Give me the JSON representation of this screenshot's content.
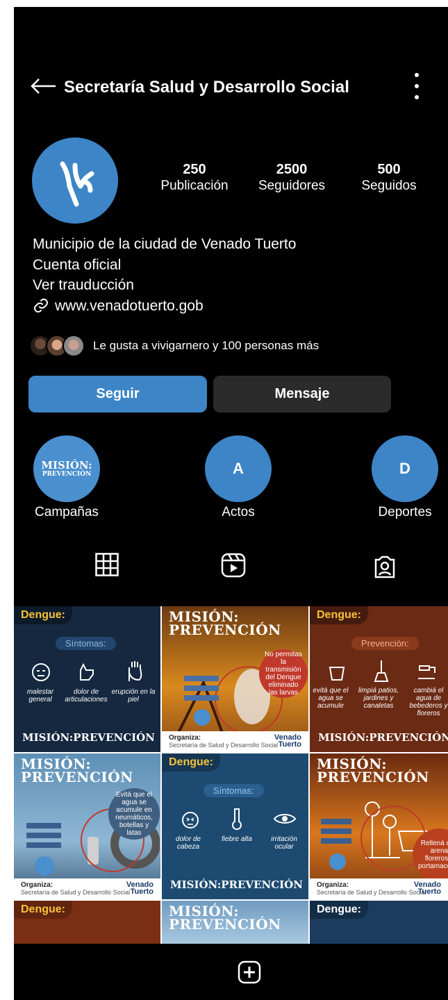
{
  "header": {
    "title": "Secretaría Salud y Desarrollo Social",
    "back_icon": "arrow-left-icon",
    "more_icon": "more-vertical-icon"
  },
  "profile": {
    "avatar_icon": "venado-tuerto-logo",
    "stats": [
      {
        "value": "250",
        "label": "Publicación"
      },
      {
        "value": "2500",
        "label": "Seguidores"
      },
      {
        "value": "500",
        "label": "Seguidos"
      }
    ],
    "bio": {
      "line1": "Municipio de la ciudad de Venado Tuerto",
      "line2": "Cuenta oficial",
      "line3": "Ver trauducción",
      "link": "www.venadotuerto.gob"
    },
    "likes_text": "Le gusta a vivigarnero y 100 personas más"
  },
  "actions": {
    "follow": "Seguir",
    "message": "Mensaje"
  },
  "highlights": [
    {
      "label": "Campañas",
      "cover_line1": "MISIÓN:",
      "cover_line2": "PREVENCIÓN"
    },
    {
      "label": "Actos",
      "cover": "A"
    },
    {
      "label": "Deportes",
      "cover": "D"
    }
  ],
  "tabs": [
    "grid-icon",
    "reels-icon",
    "tagged-icon"
  ],
  "posts": {
    "dengue": "Dengue:",
    "sintomas": "Síntomas:",
    "prevencion": "Prevención:",
    "mision": "MISIÓN:PREVENCIÓN",
    "mision_l1": "MISIÓN:",
    "mision_l2": "PREVENCIÓN",
    "organiza": "Organiza:",
    "organiza_sub": "Secretaría de Salud y Desarrollo Social",
    "vt_l1": "Venado",
    "vt_l2": "Tuerto",
    "p1": [
      "malestar general",
      "dolor de articulaciones",
      "erupción en la piel"
    ],
    "p2_bubble": "No permitas la transmisión del Dengue eliminado las larvas",
    "p3": [
      "evitá que el agua se acumule",
      "limpiá patios, jardines y canaletas",
      "cambiá el agua de bebederos y floreros"
    ],
    "p4_bubble": "Evitá que el agua se acumule en neumáticos, botellas y latas",
    "p5": [
      "dolor de cabeza",
      "fiebre alta",
      "irritación ocular"
    ],
    "p6_bubble": "Rellená con arena floreros y portamacetas"
  },
  "colors": {
    "accent": "#3d85c6",
    "dark_button": "#2b2b2b",
    "dengue_yellow": "#f7c23a"
  }
}
